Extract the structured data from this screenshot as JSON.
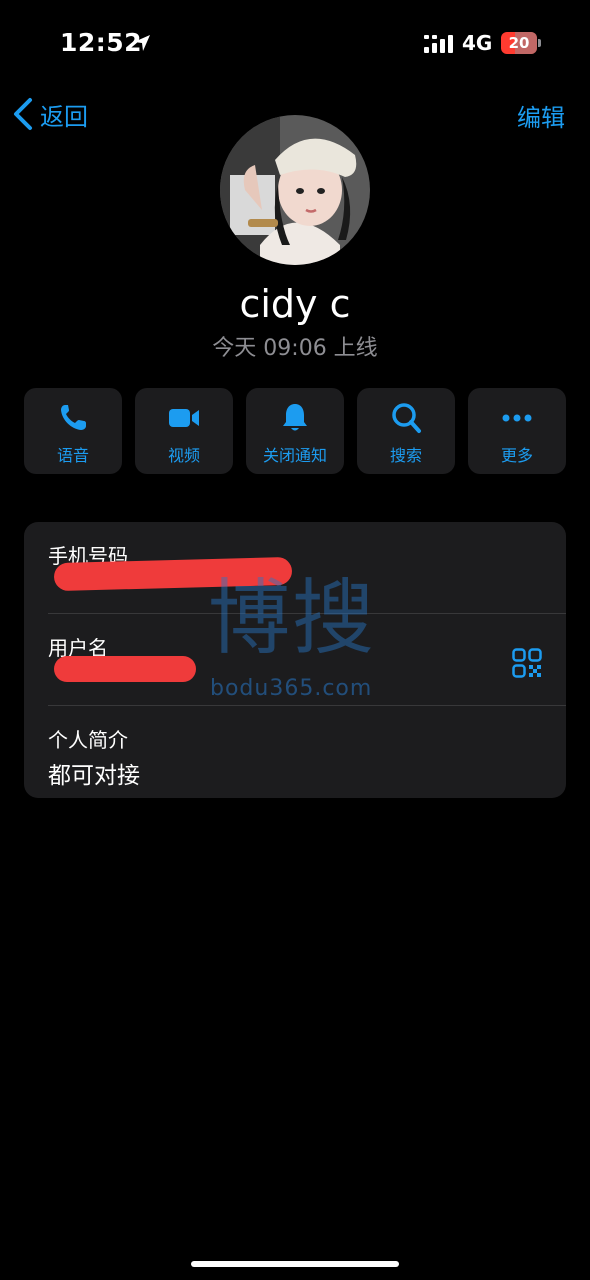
{
  "status_bar": {
    "time": "12:52",
    "network": "4G",
    "battery_level": "20"
  },
  "nav": {
    "back_label": "返回",
    "edit_label": "编辑"
  },
  "profile": {
    "name": "cidy c",
    "status": "今天 09:06 上线"
  },
  "actions": [
    {
      "label": "语音",
      "icon": "phone-icon"
    },
    {
      "label": "视频",
      "icon": "video-icon"
    },
    {
      "label": "关闭通知",
      "icon": "bell-icon"
    },
    {
      "label": "搜索",
      "icon": "search-icon"
    },
    {
      "label": "更多",
      "icon": "more-icon"
    }
  ],
  "info": {
    "phone_label": "手机号码",
    "username_label": "用户名",
    "bio_label": "个人简介",
    "bio_value": "都可对接"
  },
  "watermark": {
    "glyphs": "博搜",
    "url": "bodu365.com"
  },
  "colors": {
    "accent": "#1c9cf0",
    "card": "#1c1c1e",
    "redaction": "#ef3b3b"
  }
}
